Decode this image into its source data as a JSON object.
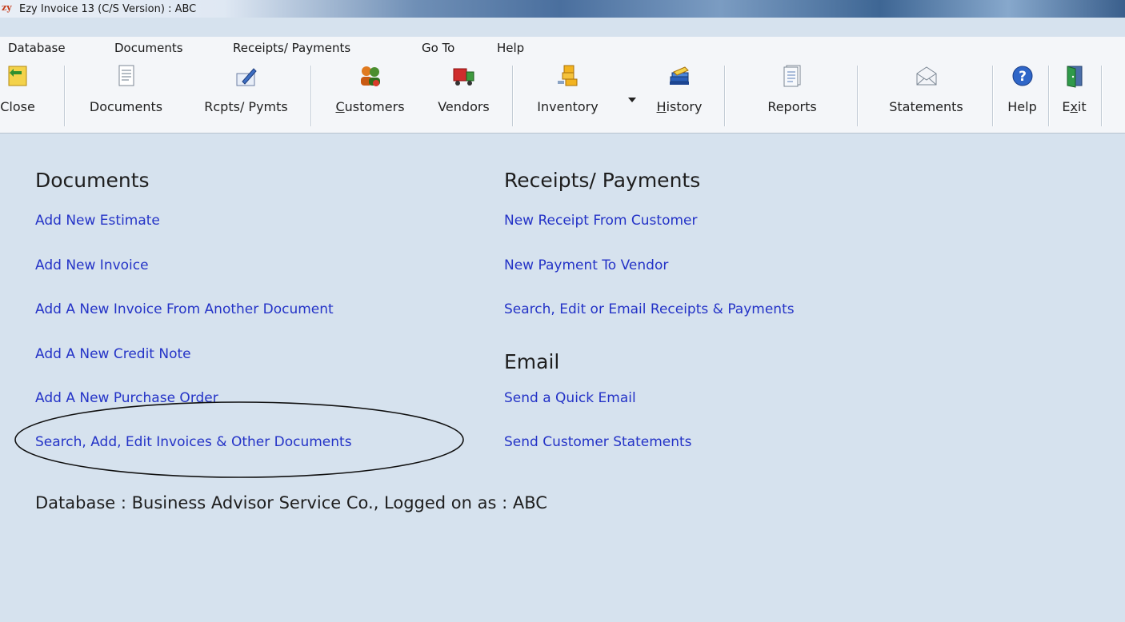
{
  "window": {
    "logo_text": "zy",
    "title": "Ezy Invoice 13 (C/S Version) : ABC"
  },
  "menu": [
    "Database",
    "Documents",
    "Receipts/ Payments",
    "Go To",
    "Help"
  ],
  "toolbar": {
    "close": "Close",
    "documents": "Documents",
    "rcpts": "Rcpts/ Pymts",
    "customers_pre": "",
    "customers_u": "C",
    "customers_post": "ustomers",
    "vendors": "Vendors",
    "inventory": "Inventory",
    "history_u": "H",
    "history_post": "istory",
    "reports": "Reports",
    "statements": "Statements",
    "help": "Help",
    "exit_pre": "E",
    "exit_u": "x",
    "exit_post": "it"
  },
  "documents": {
    "title": "Documents",
    "links": [
      "Add New Estimate",
      "Add New Invoice",
      "Add A New Invoice From Another Document",
      "Add A New Credit Note",
      "Add A New Purchase Order",
      "Search, Add, Edit Invoices & Other Documents"
    ]
  },
  "receipts": {
    "title": "Receipts/ Payments",
    "links": [
      "New Receipt From Customer",
      "New Payment To Vendor",
      "Search, Edit or Email Receipts & Payments"
    ]
  },
  "email": {
    "title": "Email",
    "links": [
      "Send a Quick Email",
      "Send Customer Statements"
    ]
  },
  "status": "Database : Business Advisor Service Co.,  Logged on as : ABC"
}
